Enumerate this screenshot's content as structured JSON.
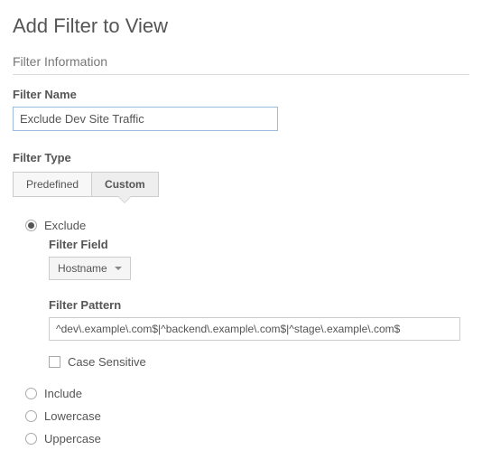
{
  "page_title": "Add Filter to View",
  "section_title": "Filter Information",
  "filter_name": {
    "label": "Filter Name",
    "value": "Exclude Dev Site Traffic"
  },
  "filter_type": {
    "label": "Filter Type",
    "tabs": {
      "predefined": "Predefined",
      "custom": "Custom"
    },
    "active": "custom"
  },
  "options": {
    "exclude": {
      "label": "Exclude",
      "selected": true,
      "filter_field": {
        "label": "Filter Field",
        "value": "Hostname"
      },
      "filter_pattern": {
        "label": "Filter Pattern",
        "value": "^dev\\.example\\.com$|^backend\\.example\\.com$|^stage\\.example\\.com$"
      },
      "case_sensitive": {
        "label": "Case Sensitive",
        "checked": false
      }
    },
    "include": {
      "label": "Include",
      "selected": false
    },
    "lowercase": {
      "label": "Lowercase",
      "selected": false
    },
    "uppercase": {
      "label": "Uppercase",
      "selected": false
    }
  }
}
